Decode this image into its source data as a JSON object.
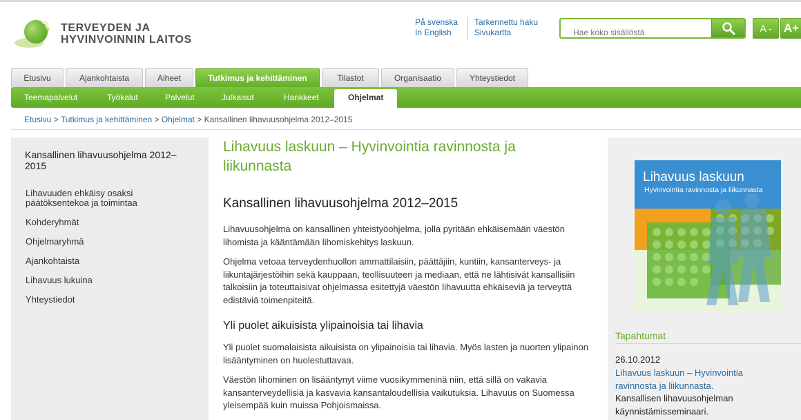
{
  "header": {
    "logo_line1": "TERVEYDEN JA",
    "logo_line2": "HYVINVOINNIN LAITOS",
    "lang_links": [
      "På svenska",
      "In English"
    ],
    "util_links": [
      "Tarkennettu haku",
      "Sivukartta"
    ],
    "search_placeholder": "Hae koko sisällöstä",
    "font_minus": "A -",
    "font_plus": "A+"
  },
  "main_tabs": [
    "Etusivu",
    "Ajankohtaista",
    "Aiheet",
    "Tutkimus ja kehittäminen",
    "Tilastot",
    "Organisaatio",
    "Yhteystiedot"
  ],
  "sub_nav": [
    "Teemapalvelut",
    "Työkalut",
    "Palvelut",
    "Julkaisut",
    "Hankkeet",
    "Ohjelmat"
  ],
  "breadcrumb": {
    "links": [
      "Etusivu",
      "Tutkimus ja kehittäminen",
      "Ohjelmat"
    ],
    "separator": ">",
    "current": "Kansallinen lihavuusohjelma 2012–2015"
  },
  "left_nav": {
    "title": "Kansallinen lihavuusohjelma 2012–2015",
    "items": [
      "Lihavuuden ehkäisy osaksi päätöksentekoa ja toimintaa",
      "Kohderyhmät",
      "Ohjelmaryhmä",
      "Ajankohtaista",
      "Lihavuus lukuina",
      "Yhteystiedot"
    ]
  },
  "content": {
    "title": "Lihavuus laskuun – Hyvinvointia ravinnosta ja liikunnasta",
    "subtitle": "Kansallinen lihavuusohjelma 2012–2015",
    "para1": "Lihavuusohjelma on kansallinen yhteistyöohjelma, jolla pyritään ehkäisemään väestön lihomista ja kääntämään lihomiskehitys laskuun.",
    "para2": "Ohjelma vetoaa terveydenhuollon ammattilaisiin, päättäjiin, kuntiin, kansanterveys- ja liikuntajärjestöihin sekä kauppaan, teollisuuteen ja mediaan, että ne lähtisivät kansallisiin talkoisiin ja toteuttaisivat ohjelmassa esitettyjä väestön lihavuutta ehkäiseviä ja terveyttä edistäviä toimenpiteitä.",
    "section_heading": "Yli puolet aikuisista ylipainoisia tai lihavia",
    "para3": "Yli puolet suomalaisista aikuisista on ylipainoisia tai lihavia. Myös lasten ja nuorten ylipainon lisääntyminen on huolestuttavaa.",
    "para4": "Väestön lihominen on lisääntynyt viime vuosikymmeninä niin, että sillä on vakavia kansanterveydellisiä ja kasvavia kansantaloudellisia vaikutuksia. Lihavuus on Suomessa yleisempää kuin muissa Pohjoismaissa."
  },
  "right": {
    "poster_title": "Lihavuus laskuun",
    "poster_subtitle": "Hyvinvointia ravinnosta ja liikunnasta",
    "events_title": "Tapahtumat",
    "event_date": "26.10.2012",
    "event_link": "Lihavuus laskuun – Hyvinvointia ravinnosta ja liikunnasta.",
    "event_desc": "Kansallisen lihavuusohjelman käynnistämisseminaari."
  },
  "colors": {
    "brand_green": "#6aaa2e",
    "link_blue": "#2a6aa0",
    "poster_blue": "#3a8fd0",
    "poster_orange": "#f2a01e"
  }
}
